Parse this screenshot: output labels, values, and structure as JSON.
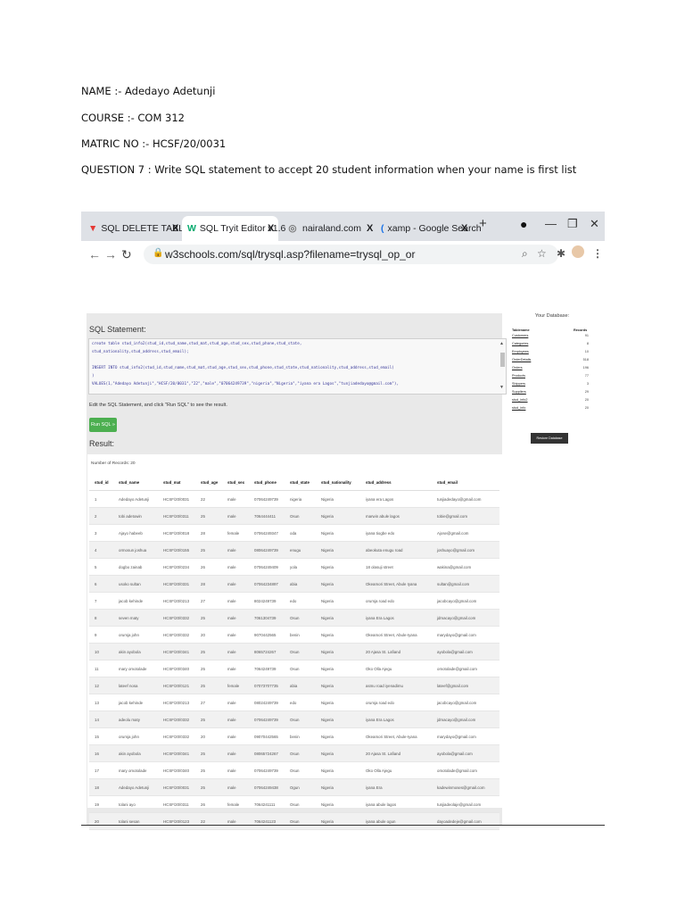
{
  "document": {
    "name": "NAME :- Adedayo Adetunji",
    "course": "COURSE :- COM 312",
    "matric": "MATRIC NO :- HCSF/20/0031",
    "question": "QUESTION 7 : Write SQL statement to accept 20 student information when your name is first list"
  },
  "browser": {
    "tabs": [
      {
        "label": "SQL DELETE TABLE - ja",
        "icon": "red-triangle-icon",
        "active": false
      },
      {
        "label": "SQL Tryit Editor v1.6",
        "icon": "w3-logo-icon",
        "active": true
      },
      {
        "label": "nairaland.com",
        "icon": "globe-icon",
        "active": false
      },
      {
        "label": "xamp - Google Search",
        "icon": "google-icon",
        "active": false
      }
    ],
    "close_glyph": "X",
    "new_tab_glyph": "+",
    "url": "w3schools.com/sql/trysql.asp?filename=trysql_op_or",
    "accent_color": "#04aa6d"
  },
  "editor": {
    "sql_heading": "SQL Statement:",
    "code_lines": [
      "create table stud_info2(stud_id,stud_name,stud_mat,stud_age,stud_sex,stud_phone,stud_state,",
      "stud_nationality,stud_address,stud_email);",
      "",
      "INSERT INTO stud_info2(stud_id,stud_name,stud_mat,stud_age,stud_sex,stud_phone,stud_state,stud_nationality,stud_address,stud_email)",
      ")",
      "VALUES(1,\"Adedayo Adetunji\",\"HCSF/20/0031\",\"22\",\"male\",\"07064249739\",\"nigeria\",\"Nigeria\",\"iyana era Lagos\",\"tunjiadedayo@gmail.com\"),"
    ],
    "hint": "Edit the SQL Statement, and click \"Run SQL\" to see the result.",
    "run_label": "Run SQL »",
    "result_heading": "Result:",
    "records_label": "Number of Records: 20"
  },
  "result": {
    "columns": [
      "stud_id",
      "stud_name",
      "stud_mat",
      "stud_age",
      "stud_sex",
      "stud_phone",
      "stud_state",
      "stud_nationality",
      "stud_address",
      "stud_email"
    ],
    "rows": [
      [
        "1",
        "Adedayo Adetunji",
        "HCSF/20/0031",
        "22",
        "male",
        "07064249739",
        "nigeria",
        "Nigeria",
        "iyana era Lagos",
        "tunjiadedayo@gmail.com"
      ],
      [
        "2",
        "tobi adetowin",
        "HCSF/20/0311",
        "25",
        "male",
        "7064444411",
        "Osun",
        "Nigeria",
        "marwin abule lagos",
        "tobie@gmail.com"
      ],
      [
        "3",
        "Ajayo habeeb",
        "HCSF/20/0018",
        "28",
        "female",
        "07064249347",
        "oda",
        "Nigeria",
        "iyana tiogbe edo",
        "Ajose@gmail.com"
      ],
      [
        "4",
        "ormosun joshua",
        "HCSF/20/0155",
        "25",
        "male",
        "08064249739",
        "enugu",
        "Nigeria",
        "abeokuta enugu road",
        "joshuayo@gmail.com"
      ],
      [
        "5",
        "dogbo zainab",
        "HCSF/20/0234",
        "26",
        "male",
        "07064249409",
        "yola",
        "Nigeria",
        "18 olasuji street",
        "wakina@gmail.com"
      ],
      [
        "6",
        "usoko sultan",
        "HCSF/20/0331",
        "28",
        "male",
        "07064234897",
        "abia",
        "Nigeria",
        "Okeamori Street, Abule Iyana",
        "sultan@gmail.com"
      ],
      [
        "7",
        "jacob kehinde",
        "HCSF/20/0213",
        "27",
        "male",
        "8024249739",
        "edo",
        "Nigeria",
        "orumja road edo",
        "jacobcayo@gmail.com"
      ],
      [
        "8",
        "seven maty",
        "HCSF/20/0332",
        "25",
        "male",
        "7061304739",
        "Osun",
        "Nigeria",
        "iyana Era Lagos",
        "jdmacayo@gmail.com"
      ],
      [
        "9",
        "orumja john",
        "HCSF/20/0332",
        "20",
        "male",
        "9070442565",
        "benin",
        "Nigeria",
        "Okeamori Street, Abule-Iyana",
        "marydayo@gmail.com"
      ],
      [
        "10",
        "akin ayobola",
        "HCSF/20/0341",
        "25",
        "male",
        "8065724267",
        "Osun",
        "Nigeria",
        "20 Ajasa St. Lafiand",
        "ayobola@gmail.com"
      ],
      [
        "11",
        "mary omotolade",
        "HCSF/20/0340",
        "25",
        "male",
        "7064249739",
        "Osun",
        "Nigeria",
        "Oko Olla Ajegu",
        "omotolade@gmail.com"
      ],
      [
        "12",
        "lateef nosa",
        "HCSF/20/0121",
        "25",
        "female",
        "07073707735",
        "abia",
        "Nigeria",
        "asmu road iyenadimu",
        "lateef@gmail.com"
      ],
      [
        "13",
        "jacob kehinde",
        "HCSF/20/0213",
        "27",
        "male",
        "08024249739",
        "edo",
        "Nigeria",
        "orumja road edo",
        "jacobcayo@gmail.com"
      ],
      [
        "14",
        "adeolu maty",
        "HCSF/20/0332",
        "25",
        "male",
        "07064249739",
        "Osun",
        "Nigeria",
        "iyana Era Lagos",
        "jdmacayo@gmail.com"
      ],
      [
        "15",
        "orumja john",
        "HCSF/20/0332",
        "20",
        "male",
        "09070442565",
        "benin",
        "Nigeria",
        "Okeamori Street, Abule-Iyana",
        "marydayo@gmail.com"
      ],
      [
        "16",
        "akin ayobola",
        "HCSF/20/0341",
        "25",
        "male",
        "08065724267",
        "Osun",
        "Nigeria",
        "20 Ajasa St. Lafiand",
        "ayobola@gmail.com"
      ],
      [
        "17",
        "mary omotolade",
        "HCSF/20/0340",
        "25",
        "male",
        "07064249739",
        "Osun",
        "Nigeria",
        "Oko Olla Ajegu",
        "omotolade@gmail.com"
      ],
      [
        "18",
        "Adedayo Adetunji",
        "HCSF/20/0031",
        "25",
        "male",
        "07064249438",
        "Ogun",
        "Nigeria",
        "iyana Era",
        "kadewinmoses@gmail.com"
      ],
      [
        "19",
        "tolani ayo",
        "HCSF/20/0311",
        "26",
        "female",
        "7064241111",
        "Osun",
        "Nigeria",
        "iyana abule lagos",
        "tunjiadeolaje@gmail.com"
      ],
      [
        "20",
        "tolani sesan",
        "HCSF/20/0123",
        "22",
        "male",
        "7064241123",
        "Osun",
        "Nigeria",
        "iyana abule ogun",
        "dayoadedeje@gmail.com"
      ]
    ]
  },
  "database": {
    "title": "Your Database:",
    "headers": [
      "Tablename",
      "Records"
    ],
    "tables": [
      {
        "name": "Customers",
        "records": "91"
      },
      {
        "name": "Categories",
        "records": "8"
      },
      {
        "name": "Employees",
        "records": "10"
      },
      {
        "name": "OrderDetails",
        "records": "518"
      },
      {
        "name": "Orders",
        "records": "196"
      },
      {
        "name": "Products",
        "records": "77"
      },
      {
        "name": "Shippers",
        "records": "3"
      },
      {
        "name": "Suppliers",
        "records": "29"
      },
      {
        "name": "stud_info2",
        "records": "20"
      },
      {
        "name": "stud_info",
        "records": "20"
      }
    ],
    "restore_label": "Restore Database"
  }
}
